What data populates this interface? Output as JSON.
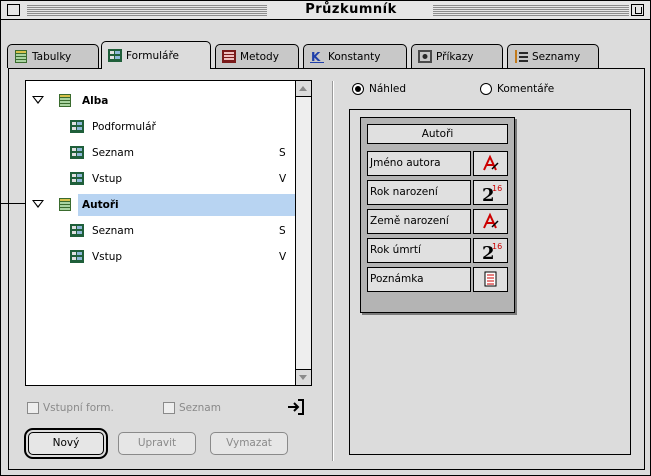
{
  "window": {
    "title": "Průzkumník"
  },
  "tabs": [
    {
      "label": "Tabulky",
      "icon": "table-icon"
    },
    {
      "label": "Formuláře",
      "icon": "form-icon",
      "active": true
    },
    {
      "label": "Metody",
      "icon": "method-icon"
    },
    {
      "label": "Konstanty",
      "icon": "constant-k-icon"
    },
    {
      "label": "Příkazy",
      "icon": "command-icon"
    },
    {
      "label": "Seznamy",
      "icon": "list-icon"
    }
  ],
  "tree": [
    {
      "label": "Alba",
      "type": "table",
      "expanded": true,
      "suffix": ""
    },
    {
      "label": "Podformulář",
      "type": "form",
      "suffix": ""
    },
    {
      "label": "Seznam",
      "type": "form",
      "suffix": "S"
    },
    {
      "label": "Vstup",
      "type": "form",
      "suffix": "V"
    },
    {
      "label": "Autoři",
      "type": "table",
      "expanded": true,
      "selected": true,
      "suffix": ""
    },
    {
      "label": "Seznam",
      "type": "form",
      "suffix": "S"
    },
    {
      "label": "Vstup",
      "type": "form",
      "suffix": "V"
    }
  ],
  "checkboxes": {
    "entry_form": "Vstupní form.",
    "list": "Seznam"
  },
  "buttons": {
    "new": "Nový",
    "edit": "Upravit",
    "delete": "Vymazat"
  },
  "radios": {
    "preview": "Náhled",
    "comments": "Komentáře",
    "selected": "preview"
  },
  "preview_table": {
    "title": "Autoři",
    "fields": [
      {
        "name": "Jméno autora",
        "type_icon": "alpha-field-icon"
      },
      {
        "name": "Rok narození",
        "type_icon": "integer-field-icon"
      },
      {
        "name": "Země narození",
        "type_icon": "alpha-field-icon"
      },
      {
        "name": "Rok úmrtí",
        "type_icon": "integer-field-icon"
      },
      {
        "name": "Poznámka",
        "type_icon": "text-field-icon"
      }
    ]
  },
  "colors": {
    "selection": "#b8d4f2",
    "background": "#dcdcdc",
    "accent_red": "#cc0000"
  }
}
